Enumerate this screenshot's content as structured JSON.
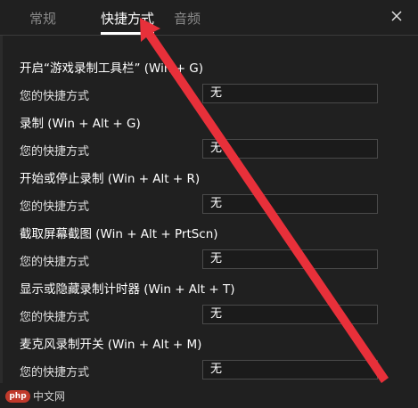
{
  "tabs": [
    {
      "label": "常规"
    },
    {
      "label": "快捷方式"
    },
    {
      "label": "音频"
    }
  ],
  "sections": [
    {
      "title": "开启“游戏录制工具栏” (Win + G)",
      "field_label": "您的快捷方式",
      "value": "无"
    },
    {
      "title": "录制 (Win + Alt + G)",
      "field_label": "您的快捷方式",
      "value": "无"
    },
    {
      "title": "开始或停止录制 (Win + Alt + R)",
      "field_label": "您的快捷方式",
      "value": "无"
    },
    {
      "title": "截取屏幕截图 (Win + Alt + PrtScn)",
      "field_label": "您的快捷方式",
      "value": "无"
    },
    {
      "title": "显示或隐藏录制计时器 (Win + Alt + T)",
      "field_label": "您的快捷方式",
      "value": "无"
    },
    {
      "title": "麦克风录制开关 (Win + Alt + M)",
      "field_label": "您的快捷方式",
      "value": "无"
    }
  ],
  "watermark": {
    "logo": "php",
    "text": "中文网"
  },
  "colors": {
    "background": "#202020",
    "annotation_arrow": "#e8303a"
  },
  "icons": {
    "close": "close-icon"
  }
}
